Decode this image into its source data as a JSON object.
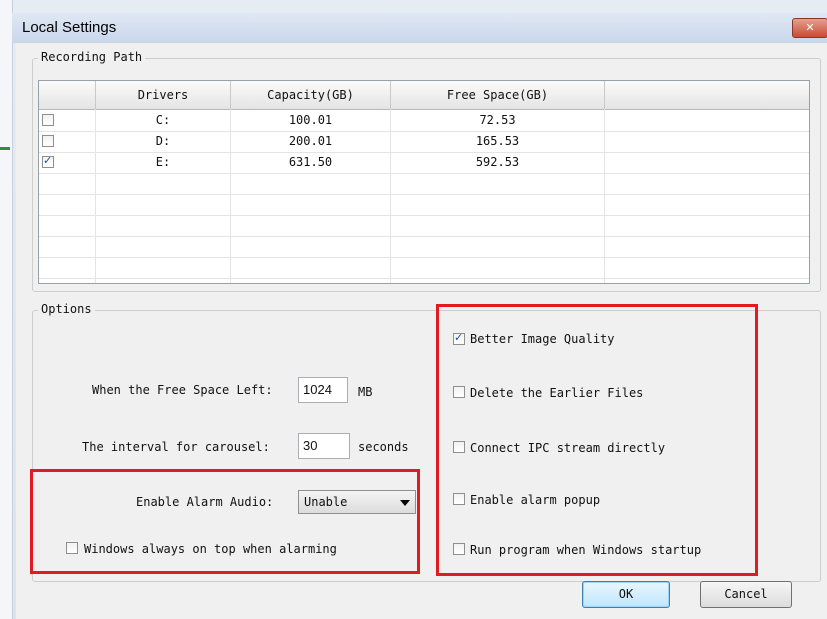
{
  "window": {
    "title": "Local Settings",
    "close_glyph": "✕"
  },
  "recording_path": {
    "label": "Recording Path",
    "columns": [
      "Drivers",
      "Capacity(GB)",
      "Free Space(GB)"
    ],
    "rows": [
      {
        "checked": false,
        "driver": "C:",
        "capacity": "100.01",
        "free": "72.53"
      },
      {
        "checked": false,
        "driver": "D:",
        "capacity": "200.01",
        "free": "165.53"
      },
      {
        "checked": true,
        "driver": "E:",
        "capacity": "631.50",
        "free": "592.53"
      }
    ]
  },
  "options": {
    "label": "Options",
    "free_space_label": "When the Free Space Left:",
    "free_space_value": "1024",
    "free_space_unit": "MB",
    "carousel_label": "The interval for carousel:",
    "carousel_value": "30",
    "carousel_unit": "seconds",
    "alarm_audio_label": "Enable Alarm Audio:",
    "alarm_audio_value": "Unable",
    "always_on_top_label": "Windows always on top when alarming",
    "always_on_top_checked": false,
    "checkboxes": [
      {
        "label": "Better Image Quality",
        "checked": true
      },
      {
        "label": "Delete the Earlier Files",
        "checked": false
      },
      {
        "label": "Connect IPC stream directly",
        "checked": false
      },
      {
        "label": "Enable alarm popup",
        "checked": false
      },
      {
        "label": "Run program when Windows startup",
        "checked": false
      }
    ]
  },
  "buttons": {
    "ok": "OK",
    "cancel": "Cancel"
  },
  "colors": {
    "highlight": "#e11b22",
    "check_blue": "#1b4f9c"
  }
}
